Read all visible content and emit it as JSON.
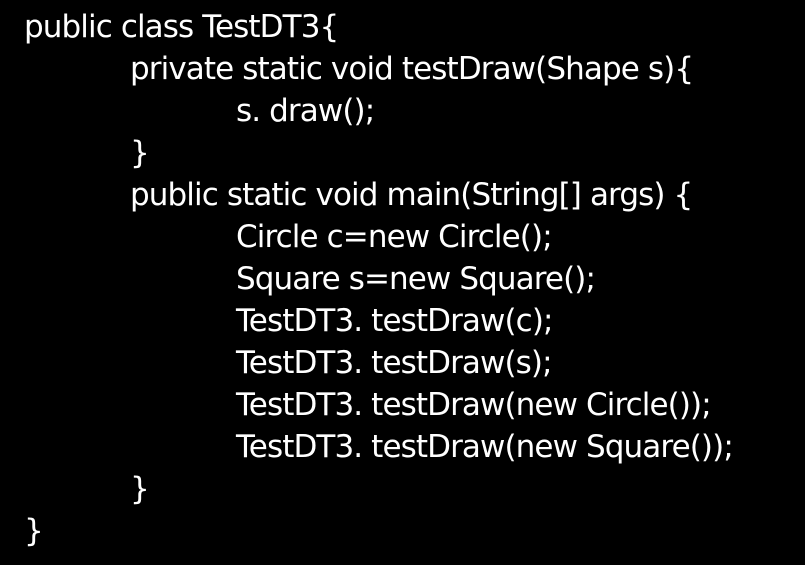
{
  "code": {
    "lines": [
      "public class TestDT3{",
      "private static void testDraw(Shape s){",
      "s. draw();",
      "}",
      "public static void main(String[] args) {",
      "Circle c=new Circle();",
      "Square s=new Square();",
      "TestDT3. testDraw(c);",
      "TestDT3. testDraw(s);",
      "TestDT3. testDraw(new Circle());",
      "TestDT3. testDraw(new Square());",
      "}",
      "}"
    ]
  }
}
